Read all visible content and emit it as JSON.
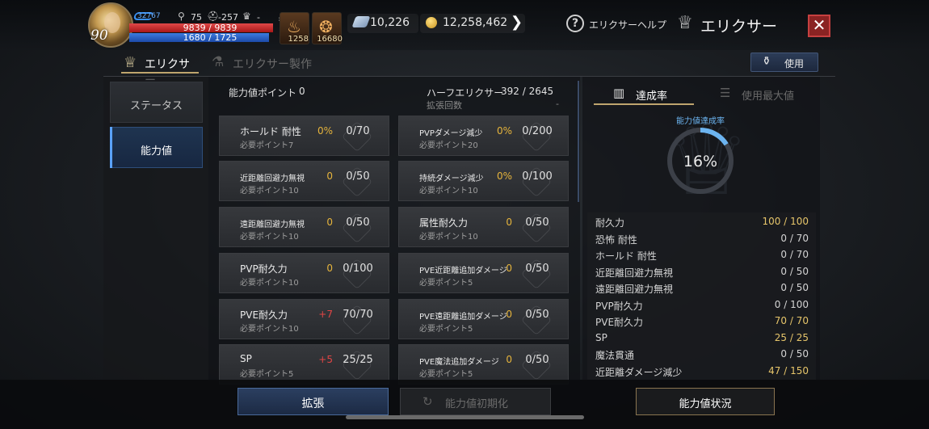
{
  "player": {
    "level": "90",
    "ring_value": "32767",
    "stat_a": "75",
    "stat_b": "-257",
    "stat_c": "-",
    "hp": "9839 / 9839",
    "mp": "1680 / 1725",
    "hp_fraction": 1.0,
    "mp_fraction": 0.974
  },
  "items": [
    {
      "icon": "potion-icon",
      "count": "1258"
    },
    {
      "icon": "elixir-item-icon",
      "count": "16680"
    }
  ],
  "currency": {
    "gem": "10,226",
    "gold": "12,258,462"
  },
  "header": {
    "help_label": "エリクサーヘルプ",
    "title": "エリクサー",
    "close_glyph": "✕"
  },
  "tabs": {
    "elixir": "エリクサー",
    "craft": "エリクサー製作",
    "use": "使用"
  },
  "nav": {
    "status": "ステータス",
    "ability": "能力値"
  },
  "center": {
    "ability_points_label": "能力値ポイント",
    "ability_points_value": "0",
    "half_elixir_label": "ハーフエリクサー",
    "half_elixir_value": "392 / 2645",
    "expansion_label": "拡張回数",
    "expansion_value": "-"
  },
  "cards": [
    {
      "name": "ホールド 耐性",
      "req": "必要ポイント7",
      "pct": "0%",
      "count": "0/70"
    },
    {
      "name": "PVPダメージ減少",
      "req": "必要ポイント20",
      "pct": "0%",
      "count": "0/200"
    },
    {
      "name": "近距離回避力無視",
      "req": "必要ポイント10",
      "pct": "0",
      "count": "0/50"
    },
    {
      "name": "持続ダメージ減少",
      "req": "必要ポイント10",
      "pct": "0%",
      "count": "0/100"
    },
    {
      "name": "遠距離回避力無視",
      "req": "必要ポイント10",
      "pct": "0",
      "count": "0/50"
    },
    {
      "name": "属性耐久力",
      "req": "必要ポイント10",
      "pct": "0",
      "count": "0/50"
    },
    {
      "name": "PVP耐久力",
      "req": "必要ポイント10",
      "pct": "0",
      "count": "0/100"
    },
    {
      "name": "PVE近距離追加ダメージ",
      "req": "必要ポイント5",
      "pct": "0",
      "count": "0/50"
    },
    {
      "name": "PVE耐久力",
      "req": "必要ポイント10",
      "pct": "+7",
      "count": "70/70"
    },
    {
      "name": "PVE遠距離追加ダメージ",
      "req": "必要ポイント5",
      "pct": "0",
      "count": "0/50"
    },
    {
      "name": "SP",
      "req": "必要ポイント5",
      "pct": "+5",
      "count": "25/25"
    },
    {
      "name": "PVE魔法追加ダメージ",
      "req": "必要ポイント5",
      "pct": "0",
      "count": "0/50"
    }
  ],
  "right": {
    "tab_rate": "達成率",
    "tab_max": "使用最大値",
    "gauge_label": "能力値達成率",
    "gauge_value": "16%",
    "gauge_fraction": 0.16,
    "stats": [
      {
        "name": "耐久力",
        "value": "100 / 100"
      },
      {
        "name": "恐怖 耐性",
        "value": "0 / 70"
      },
      {
        "name": "ホールド 耐性",
        "value": "0 / 70"
      },
      {
        "name": "近距離回避力無視",
        "value": "0 / 50"
      },
      {
        "name": "遠距離回避力無視",
        "value": "0 / 50"
      },
      {
        "name": "PVP耐久力",
        "value": "0 / 100"
      },
      {
        "name": "PVE耐久力",
        "value": "70 / 70"
      },
      {
        "name": "SP",
        "value": "25 / 25"
      },
      {
        "name": "魔法貫通",
        "value": "0 / 50"
      },
      {
        "name": "近距離ダメージ減少",
        "value": "47 / 150"
      }
    ]
  },
  "bottom": {
    "expand": "拡張",
    "reset": "能力値初期化",
    "status": "能力値状況"
  },
  "colors": {
    "accent_gold": "#bfa56e",
    "value_orange": "#e6b43c",
    "bonus_red": "#e04545",
    "gauge_blue": "#6cb4f0",
    "close_red": "#8a2323"
  }
}
